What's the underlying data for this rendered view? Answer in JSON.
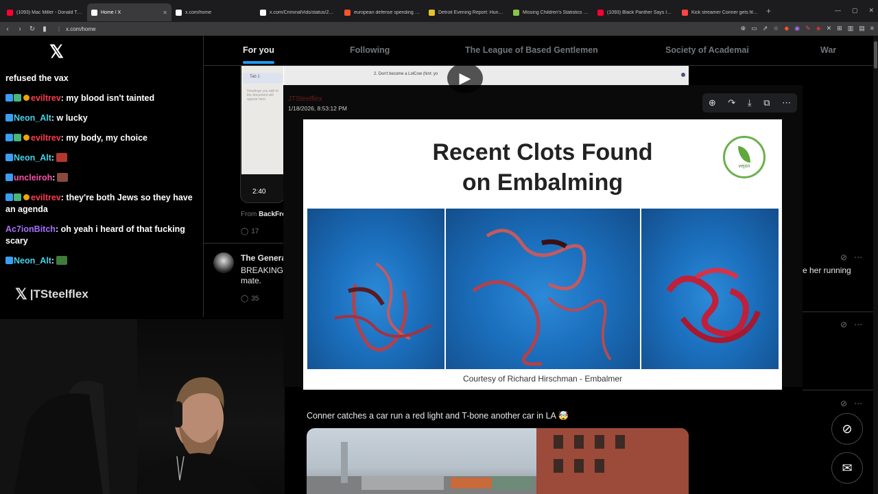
{
  "browser": {
    "tabs": [
      {
        "title": "(1093) Mac Miller - Donald Trump - Y",
        "favicon_color": "#ff0033",
        "icon": "youtube-icon"
      },
      {
        "title": "Home / X",
        "favicon_color": "#ffffff",
        "icon": "x-icon",
        "active": true
      },
      {
        "title": "x.com/home",
        "favicon_color": "#ffffff",
        "icon": "x-icon"
      },
      {
        "title": "x.com/CriminalVids/status/20123115",
        "favicon_color": "#ffffff",
        "icon": "x-icon"
      },
      {
        "title": "european defense spending - Brave S",
        "favicon_color": "#fb542b",
        "icon": "brave-icon"
      },
      {
        "title": "Detroit Evening Report: Hundreds in",
        "favicon_color": "#e6c229",
        "icon": "news-icon"
      },
      {
        "title": "Missing Children's Statistics - Global",
        "favicon_color": "#8bc34a",
        "icon": "site-icon"
      },
      {
        "title": "(1093) Black Panther Says Ice is Goin",
        "favicon_color": "#ff0033",
        "icon": "youtube-icon"
      },
      {
        "title": "Kick streamer Conner gets filmed by",
        "favicon_color": "#ff4444",
        "icon": "site-icon"
      }
    ],
    "url": "x.com/home"
  },
  "x": {
    "timeline_tabs": [
      "For you",
      "Following",
      "The League of Based Gentlemen",
      "Society of Academai",
      "War"
    ],
    "video_post": {
      "duration": "2:40",
      "from_label": "From",
      "from_source": "BackFro",
      "replies": "17"
    },
    "tweet2": {
      "name": "The Genera",
      "body_line1": "BREAKING:",
      "body_line2": "mate.",
      "replies": "35",
      "right_fragment": "e her running"
    },
    "lower_post_text": "Conner catches a car run a red light and T-bone another car in LA 🤯"
  },
  "chat": {
    "messages": [
      {
        "user": "",
        "text": "refused the vax",
        "color": "#ffffff"
      },
      {
        "user": "eviltrev",
        "text": ": my blood isn't tainted",
        "color": "#ff3b4f",
        "badges": 3
      },
      {
        "user": "Neon_Alt",
        "text": ": w lucky",
        "color": "#46d1e8",
        "badges": 1
      },
      {
        "user": "eviltrev",
        "text": ": my body, my choice",
        "color": "#ff3b4f",
        "badges": 3
      },
      {
        "user": "Neon_Alt",
        "text": ":",
        "color": "#46d1e8",
        "badges": 1,
        "emote": "#b5372e"
      },
      {
        "user": "uncleiroh",
        "text": ":",
        "color": "#ff4fa8",
        "badges": 1,
        "emote": "#8a4a3b"
      },
      {
        "user": "eviltrev",
        "text": ": they're both Jews so they have an agenda",
        "color": "#ff3b4f",
        "badges": 3
      },
      {
        "user": "Ac7ionBitch",
        "text": ": oh yeah i heard of that fucking scary",
        "color": "#a970ff",
        "badges": 0
      },
      {
        "user": "Neon_Alt",
        "text": ":",
        "color": "#46d1e8",
        "badges": 1,
        "emote": "#3f7b3b"
      }
    ]
  },
  "overlay": {
    "handle": "TSteelflex",
    "poster_name": "JTSteelflex",
    "timestamp": "1/18/2026, 8:53:12 PM",
    "image_title_line1": "Recent Clots Found",
    "image_title_line2": "on Embalming",
    "logo_text": "vejon",
    "caption": "Courtesy of Richard Hirschman - Embalmer",
    "video_tab_label": "Tab 1",
    "video_text": "2.  Don't become a LolCow (hint: yo",
    "video_heading_text": "Headings you add to the document will appear here."
  }
}
